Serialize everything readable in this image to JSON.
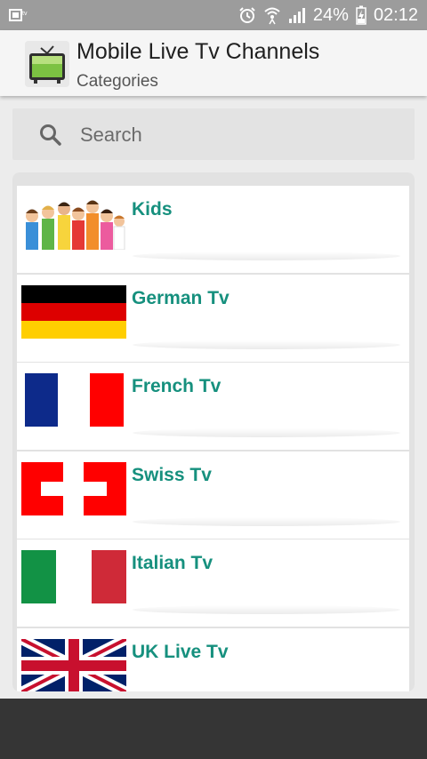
{
  "status_bar": {
    "battery": "24%",
    "time": "02:12"
  },
  "app_bar": {
    "title": "Mobile Live Tv Channels",
    "subtitle": "Categories"
  },
  "search": {
    "placeholder": "Search"
  },
  "categories": [
    {
      "label": "Kids",
      "icon": "kids-photo"
    },
    {
      "label": "German Tv",
      "icon": "german-flag"
    },
    {
      "label": "French Tv",
      "icon": "french-flag"
    },
    {
      "label": "Swiss Tv",
      "icon": "swiss-flag"
    },
    {
      "label": "Italian Tv",
      "icon": "italian-flag"
    },
    {
      "label": "UK Live Tv",
      "icon": "uk-flag"
    }
  ],
  "colors": {
    "accent_text": "#16907e",
    "status_bar": "#9c9c9c",
    "bottom_bar": "#353535"
  }
}
